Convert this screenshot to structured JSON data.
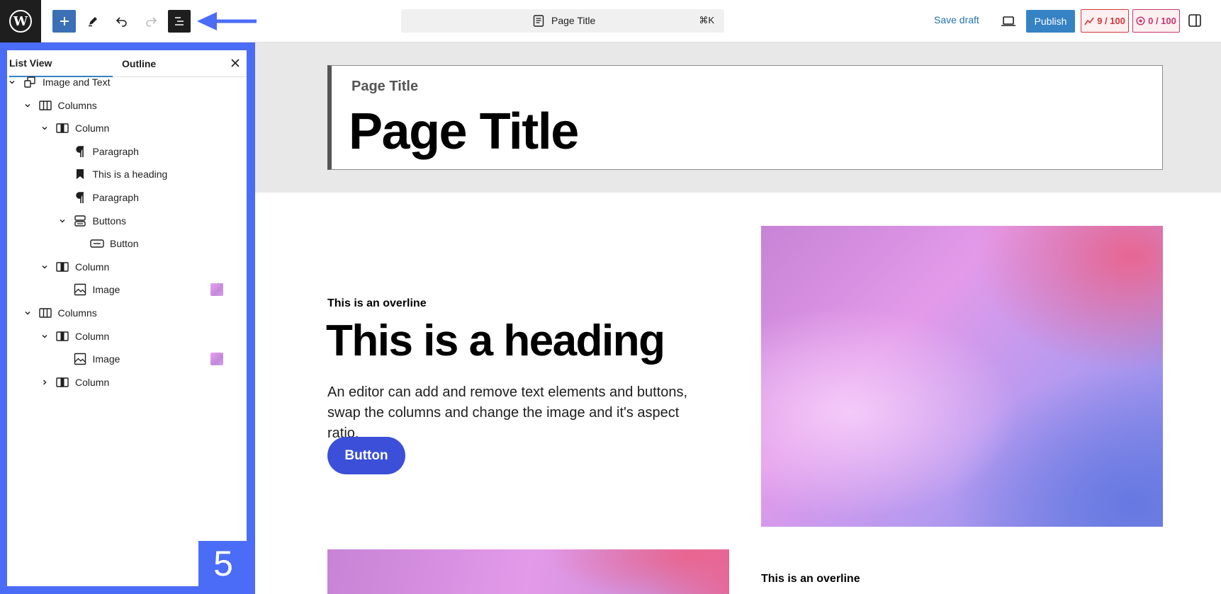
{
  "topbar": {
    "document_title": "Page Title",
    "shortcut": "⌘K",
    "save_draft": "Save draft",
    "publish": "Publish",
    "seo_score": "9 / 100",
    "readability_score": "0 / 100"
  },
  "list_panel": {
    "tabs": [
      {
        "label": "List View",
        "active": true
      },
      {
        "label": "Outline",
        "active": false
      }
    ],
    "tree": [
      {
        "label": "Image and Text",
        "icon": "pattern-icon",
        "level": 0,
        "expander": "expanded",
        "thumb": false
      },
      {
        "label": "Columns",
        "icon": "columns-icon",
        "level": 1,
        "expander": "expanded",
        "thumb": false
      },
      {
        "label": "Column",
        "icon": "column-icon",
        "level": 2,
        "expander": "expanded",
        "thumb": false
      },
      {
        "label": "Paragraph",
        "icon": "paragraph-icon",
        "level": 3,
        "expander": "none",
        "thumb": false
      },
      {
        "label": "This is a heading",
        "icon": "heading-icon",
        "level": 3,
        "expander": "none",
        "thumb": false
      },
      {
        "label": "Paragraph",
        "icon": "paragraph-icon",
        "level": 3,
        "expander": "none",
        "thumb": false
      },
      {
        "label": "Buttons",
        "icon": "buttons-icon",
        "level": 3,
        "expander": "expanded",
        "thumb": false
      },
      {
        "label": "Button",
        "icon": "button-icon",
        "level": 4,
        "expander": "none",
        "thumb": false
      },
      {
        "label": "Column",
        "icon": "column-icon",
        "level": 2,
        "expander": "expanded",
        "thumb": false
      },
      {
        "label": "Image",
        "icon": "image-icon",
        "level": 3,
        "expander": "none",
        "thumb": true
      },
      {
        "label": "Columns",
        "icon": "columns-icon",
        "level": 1,
        "expander": "expanded",
        "thumb": false
      },
      {
        "label": "Column",
        "icon": "column-icon",
        "level": 2,
        "expander": "expanded",
        "thumb": false
      },
      {
        "label": "Image",
        "icon": "image-icon",
        "level": 3,
        "expander": "none",
        "thumb": true
      },
      {
        "label": "Column",
        "icon": "column-icon",
        "level": 2,
        "expander": "collapsed",
        "thumb": false
      }
    ],
    "step_number": "5"
  },
  "canvas": {
    "title_small": "Page Title",
    "title_large": "Page Title",
    "section1": {
      "overline": "This is an overline",
      "heading": "This is a heading",
      "body": "An editor can add and remove text elements and buttons, swap the columns and change the image and it's aspect ratio.",
      "button": "Button"
    },
    "section2": {
      "overline": "This is an overline"
    }
  },
  "colors": {
    "accent": "#3582c4",
    "callout": "#4a6cf7",
    "cta": "#3b4fd8"
  }
}
